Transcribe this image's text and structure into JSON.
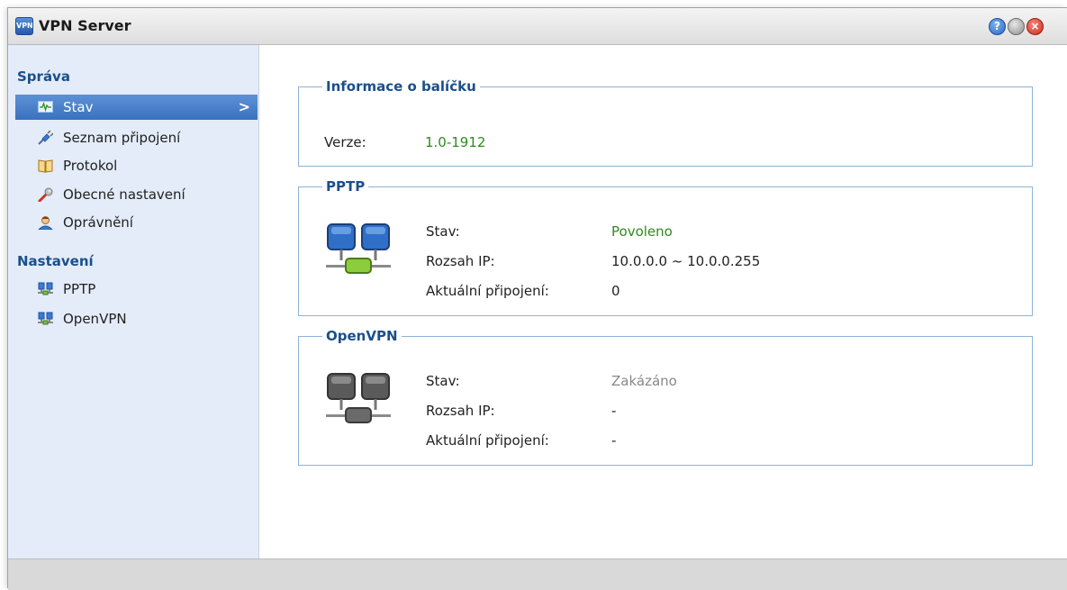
{
  "window": {
    "app_icon_text": "VPN",
    "title": "VPN Server"
  },
  "sidebar": {
    "sections": [
      {
        "title": "Správa",
        "items": [
          {
            "label": "Stav",
            "icon": "monitor-icon"
          },
          {
            "label": "Seznam připojení",
            "icon": "plug-icon"
          },
          {
            "label": "Protokol",
            "icon": "book-icon"
          },
          {
            "label": "Obecné nastavení",
            "icon": "wrench-icon"
          },
          {
            "label": "Oprávnění",
            "icon": "user-icon"
          }
        ]
      },
      {
        "title": "Nastavení",
        "items": [
          {
            "label": "PPTP",
            "icon": "network-icon"
          },
          {
            "label": "OpenVPN",
            "icon": "network-icon"
          }
        ]
      }
    ],
    "active_item": "Stav"
  },
  "package_info": {
    "legend": "Informace o balíčku",
    "version_label": "Verze:",
    "version_value": "1.0-1912"
  },
  "pptp": {
    "legend": "PPTP",
    "status_label": "Stav:",
    "status_value": "Povoleno",
    "ip_range_label": "Rozsah IP:",
    "ip_range_value": "10.0.0.0 ~ 10.0.0.255",
    "connections_label": "Aktuální připojení:",
    "connections_value": "0"
  },
  "openvpn": {
    "legend": "OpenVPN",
    "status_label": "Stav:",
    "status_value": "Zakázáno",
    "ip_range_label": "Rozsah IP:",
    "ip_range_value": "-",
    "connections_label": "Aktuální připojení:",
    "connections_value": "-"
  },
  "colors": {
    "enabled": "#2e8b1e",
    "disabled": "#888888",
    "accent": "#1b4f8c",
    "active_nav": "#4a80c9"
  }
}
